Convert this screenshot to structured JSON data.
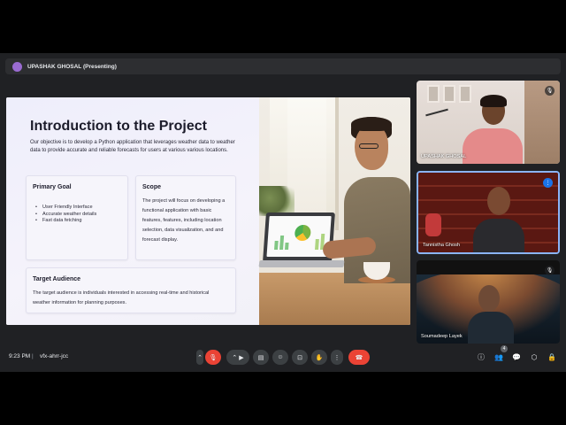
{
  "topbar": {
    "presenter_label": "UPASHAK GHOSAL (Presenting)"
  },
  "slide": {
    "title": "Introduction to the Project",
    "objective": "Our objective is to develop a Python application that leverages weather data to weather data to provide accurate and reliable forecasts for users at various various locations.",
    "primary_goal": {
      "heading": "Primary Goal",
      "items": [
        "User Friendly Interface",
        "Accurate weather details",
        "Fast data fetching"
      ]
    },
    "scope": {
      "heading": "Scope",
      "text": "The project will focus on developing a functional application with basic features, features, including location selection, data visualization, and and forecast display."
    },
    "target": {
      "heading": "Target Audience",
      "text": "The target audience is individuals interested in accessing real-time and historical weather information for planning purposes."
    }
  },
  "participants": [
    {
      "name": "UPASHAK GHOSAL",
      "status": "mic-off"
    },
    {
      "name": "Tannistha Ghosh",
      "status": "speaking"
    },
    {
      "name": "Soumadeep Layek",
      "status": "mic-off"
    }
  ],
  "controls": {
    "time": "9:23 PM",
    "separator": "|",
    "meeting_code": "vfx-ahrr-jcc",
    "people_count": "4"
  },
  "colors": {
    "end_call": "#ea4335",
    "speaking": "#1a73e8",
    "control_bg": "#3c4043"
  }
}
